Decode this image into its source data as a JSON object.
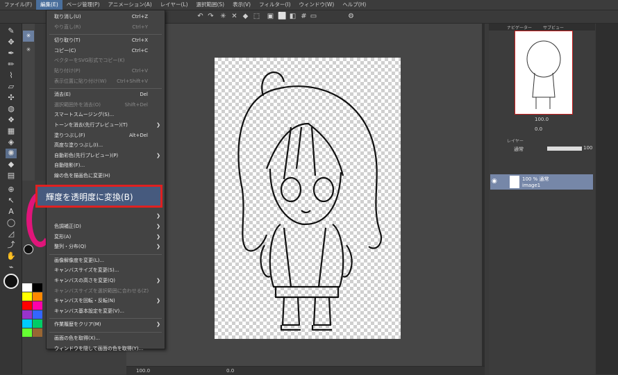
{
  "menubar": [
    "ファイル(F)",
    "編集(E)",
    "ページ管理(P)",
    "アニメーション(A)",
    "レイヤー(L)",
    "選択範囲(S)",
    "表示(V)",
    "フィルター(I)",
    "ウィンドウ(W)",
    "ヘルプ(H)"
  ],
  "menubar_active_index": 1,
  "edit_menu": {
    "items": [
      {
        "label": "取り消し(U)",
        "shortcut": "Ctrl+Z",
        "disabled": false,
        "submenu": false
      },
      {
        "label": "やり直し(R)",
        "shortcut": "Ctrl+Y",
        "disabled": true,
        "submenu": false
      },
      {
        "sep": true
      },
      {
        "label": "切り取り(T)",
        "shortcut": "Ctrl+X",
        "disabled": false,
        "submenu": false
      },
      {
        "label": "コピー(C)",
        "shortcut": "Ctrl+C",
        "disabled": false,
        "submenu": false
      },
      {
        "label": "ベクターをSVG形式でコピー(K)",
        "shortcut": "",
        "disabled": true,
        "submenu": false
      },
      {
        "label": "貼り付け(P)",
        "shortcut": "Ctrl+V",
        "disabled": true,
        "submenu": false
      },
      {
        "label": "表示位置に貼り付け(W)",
        "shortcut": "Ctrl+Shift+V",
        "disabled": true,
        "submenu": false
      },
      {
        "sep": true
      },
      {
        "label": "消去(E)",
        "shortcut": "Del",
        "disabled": false,
        "submenu": false
      },
      {
        "label": "選択範囲外を消去(O)",
        "shortcut": "Shift+Del",
        "disabled": true,
        "submenu": false
      },
      {
        "label": "スマートスムージング(S)...",
        "shortcut": "",
        "disabled": false,
        "submenu": false
      },
      {
        "label": "トーンを消去(先行プレビュー)(T)",
        "shortcut": "",
        "disabled": false,
        "submenu": true
      },
      {
        "label": "塗りつぶし(F)",
        "shortcut": "Alt+Del",
        "disabled": false,
        "submenu": false
      },
      {
        "label": "高度な塗りつぶし(I)...",
        "shortcut": "",
        "disabled": false,
        "submenu": false
      },
      {
        "label": "自動彩色(先行プレビュー)(P)",
        "shortcut": "",
        "disabled": false,
        "submenu": true
      },
      {
        "label": "自動陰影(F)...",
        "shortcut": "",
        "disabled": false,
        "submenu": false
      },
      {
        "label": "線の色を描画色に変更(H)",
        "shortcut": "",
        "disabled": false,
        "submenu": false
      },
      {
        "label": "",
        "shortcut": "",
        "disabled": false,
        "submenu": false
      },
      {
        "label": "",
        "shortcut": "",
        "disabled": false,
        "submenu": false
      },
      {
        "label": "",
        "shortcut": "",
        "disabled": false,
        "submenu": false
      },
      {
        "label": "",
        "shortcut": "",
        "disabled": false,
        "submenu": true
      },
      {
        "label": "色調補正(D)",
        "shortcut": "",
        "disabled": false,
        "submenu": true
      },
      {
        "label": "変形(A)",
        "shortcut": "",
        "disabled": false,
        "submenu": true
      },
      {
        "label": "整列・分布(Q)",
        "shortcut": "",
        "disabled": false,
        "submenu": true
      },
      {
        "sep": true
      },
      {
        "label": "画像解像度を変更(L)...",
        "shortcut": "",
        "disabled": false,
        "submenu": false
      },
      {
        "label": "キャンバスサイズを変更(S)...",
        "shortcut": "",
        "disabled": false,
        "submenu": false
      },
      {
        "label": "キャンバスの高さを変更(Q)",
        "shortcut": "",
        "disabled": false,
        "submenu": true
      },
      {
        "label": "キャンバスサイズを選択範囲に合わせる(Z)",
        "shortcut": "",
        "disabled": true,
        "submenu": false
      },
      {
        "label": "キャンバスを回転・反転(N)",
        "shortcut": "",
        "disabled": false,
        "submenu": true
      },
      {
        "label": "キャンバス基本設定を変更(V)...",
        "shortcut": "",
        "disabled": false,
        "submenu": false
      },
      {
        "sep": true
      },
      {
        "label": "作業履歴をクリア(M)",
        "shortcut": "",
        "disabled": false,
        "submenu": true
      },
      {
        "sep": true
      },
      {
        "label": "画面の色を取得(X)...",
        "shortcut": "",
        "disabled": false,
        "submenu": false
      },
      {
        "label": "ウィンドウを隠して画面の色を取得(Y)...",
        "shortcut": "",
        "disabled": false,
        "submenu": false
      }
    ],
    "highlighted": "輝度を透明度に変換(B)"
  },
  "navigator": {
    "tabs": [
      "ナビゲーター",
      "サブビュー"
    ],
    "zoom": "100.0",
    "rotation": "0.0"
  },
  "layer_panel": {
    "tab": "レイヤー",
    "blend": "通常",
    "opacity": "100",
    "layer_top": "100 % 通常",
    "layer_name": "image1"
  },
  "statusbar": {
    "zoom": "100.0",
    "angle": "0.0"
  },
  "colors": {
    "accent": "#4a6f9c",
    "highlight_border": "#e02020",
    "highlight_bg": "#465a7e",
    "layer_selected": "#7687a8"
  },
  "swatches": [
    "#ffffff",
    "#000000",
    "#ffff00",
    "#ff8800",
    "#ff0000",
    "#ff00aa",
    "#9933cc",
    "#3366ff",
    "#00ccff",
    "#00cc66",
    "#66ff33",
    "#996633"
  ]
}
